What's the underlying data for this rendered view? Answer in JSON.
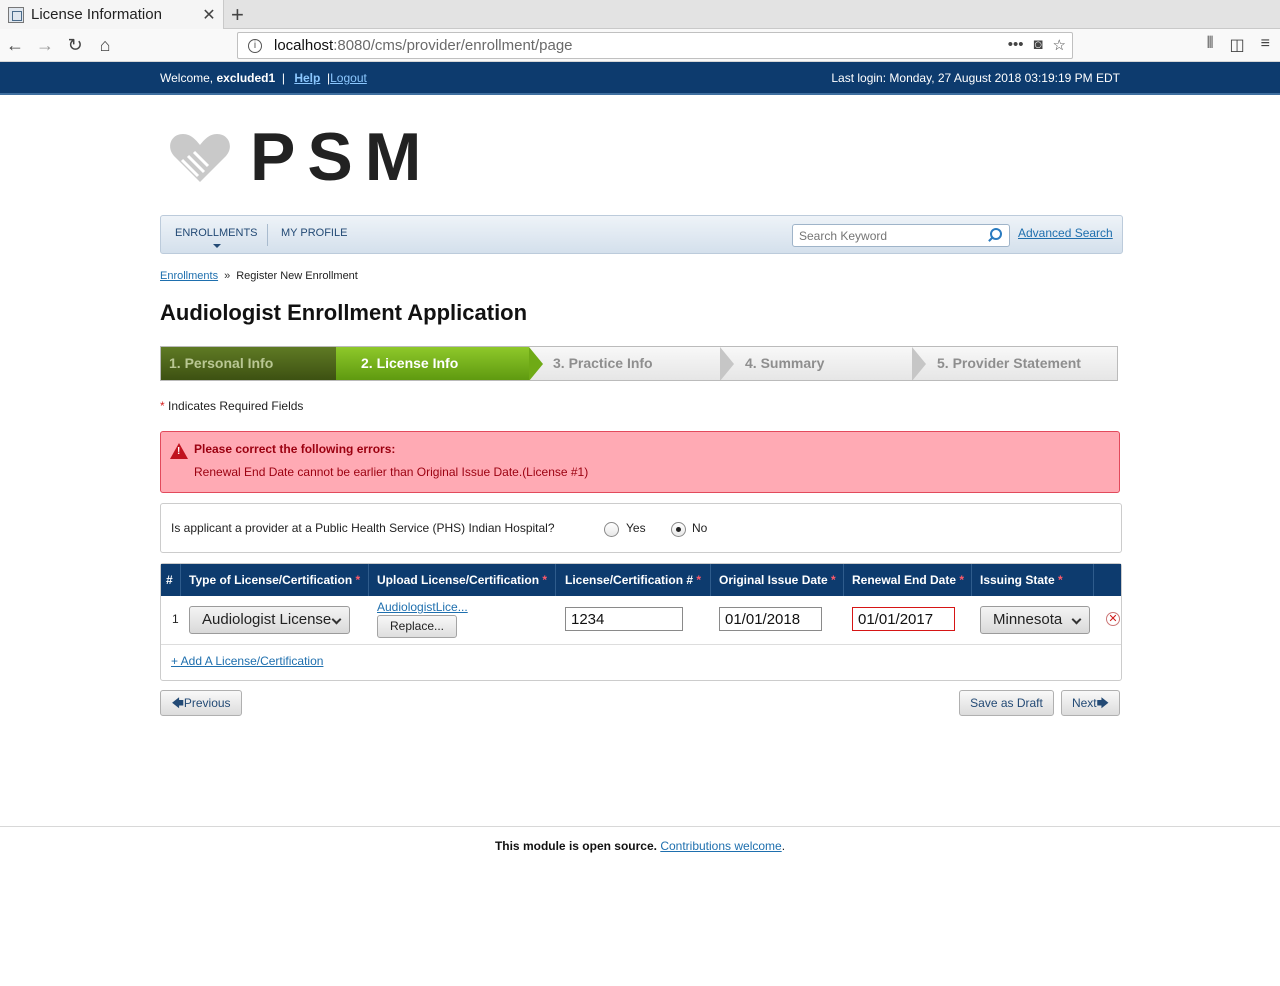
{
  "browser": {
    "tab_title": "License Information",
    "url_host": "localhost",
    "url_path": ":8080/cms/provider/enrollment/page"
  },
  "topbar": {
    "welcome": "Welcome, ",
    "username": "excluded1",
    "help": "Help",
    "logout": "Logout",
    "last_login": "Last login: Monday, 27 August 2018 03:19:19 PM EDT"
  },
  "logo_text": "PSM",
  "menu": {
    "enrollments": "ENROLLMENTS",
    "my_profile": "MY PROFILE",
    "search_placeholder": "Search Keyword",
    "advanced_search": "Advanced Search"
  },
  "breadcrumb": {
    "root": "Enrollments",
    "sep": "»",
    "current": "Register New Enrollment"
  },
  "page_title": "Audiologist Enrollment Application",
  "steps": [
    {
      "label": "1. Personal Info",
      "state": "done"
    },
    {
      "label": "2. License Info",
      "state": "current"
    },
    {
      "label": "3. Practice Info",
      "state": "todo"
    },
    {
      "label": "4. Summary",
      "state": "todo"
    },
    {
      "label": "5. Provider Statement",
      "state": "todo"
    }
  ],
  "required_note": "Indicates Required Fields",
  "error": {
    "title": "Please correct the following errors:",
    "message": "Renewal End Date cannot be earlier than Original Issue Date.(License #1)"
  },
  "phs": {
    "question": "Is applicant a provider at a Public Health Service (PHS) Indian Hospital?",
    "yes": "Yes",
    "no": "No",
    "selected": "No"
  },
  "table": {
    "headers": {
      "num": "#",
      "type": "Type of License/Certification",
      "upload": "Upload License/Certification",
      "license_no": "License/Certification #",
      "issue_date": "Original Issue Date",
      "renewal_date": "Renewal End Date",
      "state": "Issuing State"
    },
    "rows": [
      {
        "num": "1",
        "type": "Audiologist License",
        "file": "AudiologistLice...",
        "replace": "Replace...",
        "license_no": "1234",
        "issue_date": "01/01/2018",
        "renewal_date": "01/01/2017",
        "state": "Minnesota"
      }
    ],
    "add_link": "+ Add A License/Certification"
  },
  "buttons": {
    "previous": "Previous",
    "save_draft": "Save as Draft",
    "next": "Next"
  },
  "footer": {
    "text": "This module is open source.",
    "link": "Contributions welcome",
    "period": "."
  },
  "colors": {
    "header_navy": "#0d3b6e",
    "step_current_green": "#8ec82a",
    "error_bg": "#ffaab4",
    "link_blue": "#1e6fae"
  }
}
